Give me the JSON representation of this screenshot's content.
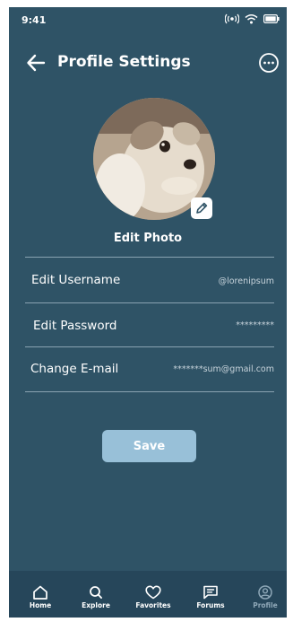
{
  "status_bar": {
    "time": "9:41"
  },
  "header": {
    "title": "Profile Settings"
  },
  "profile": {
    "edit_photo_label": "Edit Photo"
  },
  "settings": [
    {
      "label": "Edit Username",
      "value": "@lorenipsum"
    },
    {
      "label": "Edit Password",
      "value": "*********"
    },
    {
      "label": "Change E-mail",
      "value": "*******sum@gmail.com"
    }
  ],
  "save_label": "Save",
  "nav": [
    {
      "label": "Home",
      "icon": "home-icon"
    },
    {
      "label": "Explore",
      "icon": "search-icon"
    },
    {
      "label": "Favorites",
      "icon": "heart-icon"
    },
    {
      "label": "Forums",
      "icon": "forum-icon"
    },
    {
      "label": "Profile",
      "icon": "profile-icon",
      "active": true
    }
  ],
  "colors": {
    "background": "#2f5366",
    "nav_background": "#26465a",
    "save_button": "#98c0d8",
    "divider": "#8aa3b2"
  }
}
